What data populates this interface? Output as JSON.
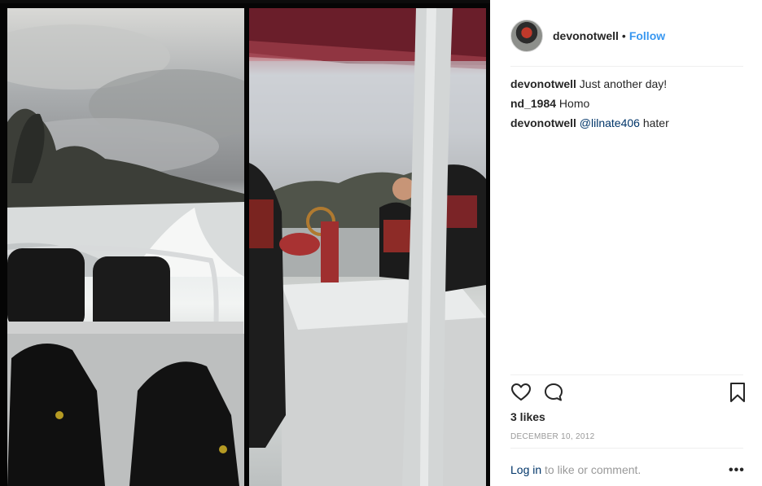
{
  "post": {
    "username": "devonotwell",
    "separator": "•",
    "follow_label": "Follow"
  },
  "comments": [
    {
      "user": "devonotwell",
      "text": " Just another day!",
      "mention": "",
      "after": ""
    },
    {
      "user": "nd_1984",
      "text": " Homo",
      "mention": "",
      "after": ""
    },
    {
      "user": "devonotwell",
      "text": " ",
      "mention": "@lilnate406",
      "after": " hater"
    }
  ],
  "actions": {
    "icons": [
      "heart-icon",
      "comment-icon",
      "bookmark-icon"
    ]
  },
  "likes": "3 likes",
  "date": "DECEMBER 10, 2012",
  "footer": {
    "login_link": "Log in",
    "login_text": " to like or comment.",
    "more_icon": "•••"
  },
  "colors": {
    "accent": "#3897f0",
    "mention": "#003569",
    "muted": "#999999",
    "text": "#262626"
  }
}
